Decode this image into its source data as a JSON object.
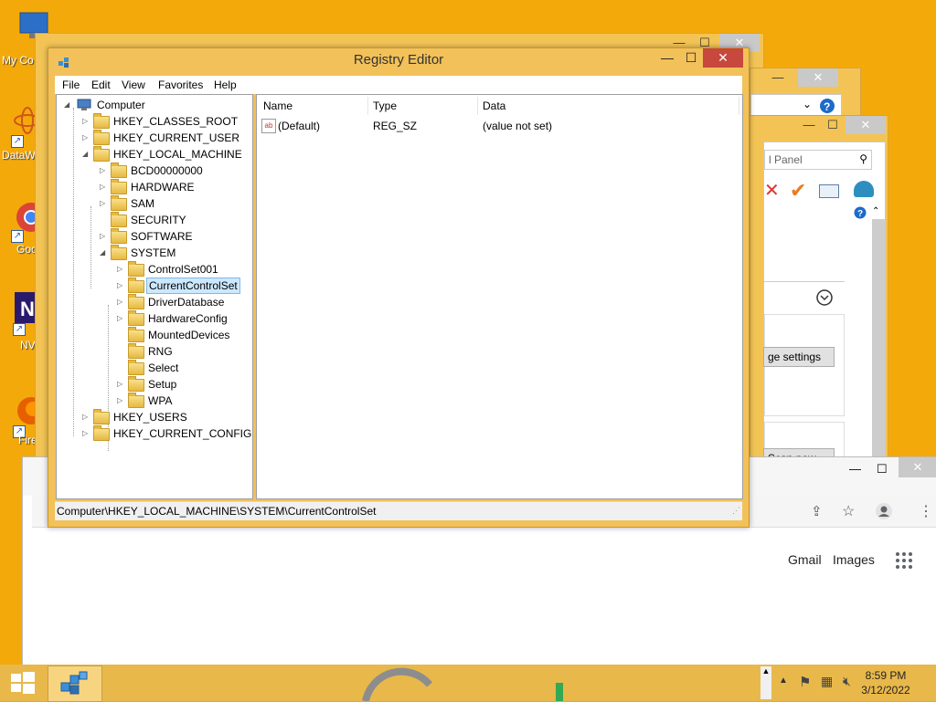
{
  "desktop": {
    "icons": [
      {
        "label": "My Co"
      },
      {
        "label": "DataW"
      },
      {
        "label": "Goo Chr"
      },
      {
        "label": "NV"
      },
      {
        "label": "Fire"
      }
    ]
  },
  "control_panel": {
    "search_placeholder": "l Panel",
    "change_settings_label": "ge settings",
    "scan_now_label": "Scan now"
  },
  "regedit": {
    "title": "Registry Editor",
    "menu": [
      "File",
      "Edit",
      "View",
      "Favorites",
      "Help"
    ],
    "tree": {
      "root": "Computer",
      "hives": [
        "HKEY_CLASSES_ROOT",
        "HKEY_CURRENT_USER",
        "HKEY_LOCAL_MACHINE",
        "HKEY_USERS",
        "HKEY_CURRENT_CONFIG"
      ],
      "hklm_children": [
        "BCD00000000",
        "HARDWARE",
        "SAM",
        "SECURITY",
        "SOFTWARE",
        "SYSTEM"
      ],
      "system_children": [
        "ControlSet001",
        "CurrentControlSet",
        "DriverDatabase",
        "HardwareConfig",
        "MountedDevices",
        "RNG",
        "Select",
        "Setup",
        "WPA"
      ],
      "selected": "CurrentControlSet"
    },
    "columns": [
      "Name",
      "Type",
      "Data"
    ],
    "values": [
      {
        "name": "(Default)",
        "type": "REG_SZ",
        "data": "(value not set)"
      }
    ],
    "status_path": "Computer\\HKEY_LOCAL_MACHINE\\SYSTEM\\CurrentControlSet"
  },
  "chrome": {
    "links": [
      "Gmail",
      "Images"
    ]
  },
  "taskbar": {
    "time": "8:59 PM",
    "date": "3/12/2022"
  },
  "colors": {
    "desktop_bg": "#f4a90a",
    "window_frame": "#f2c159",
    "close_button": "#c7483d",
    "selection": "#cce8ff"
  }
}
